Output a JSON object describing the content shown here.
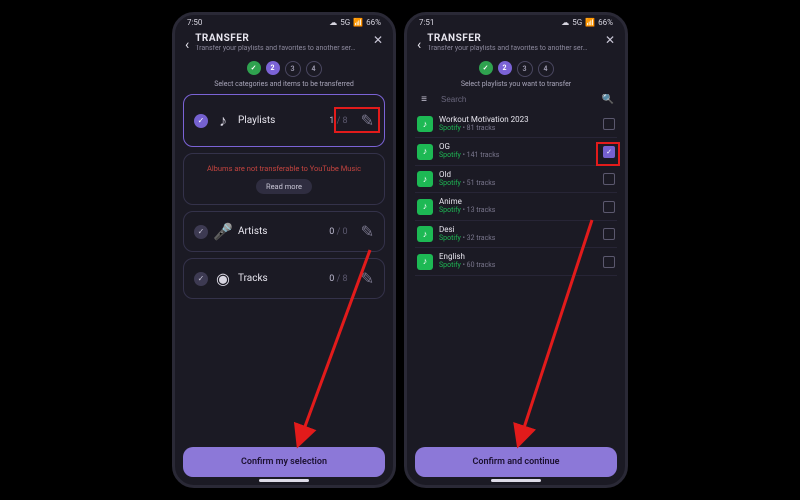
{
  "left": {
    "status": {
      "time": "7:50",
      "net": "5G",
      "battery": "66%"
    },
    "title": "TRANSFER",
    "subtitle": "Transfer your playlists and favorites to another ser…",
    "steps": [
      {
        "label": "✓",
        "state": "done"
      },
      {
        "label": "2",
        "state": "active"
      },
      {
        "label": "3",
        "state": "todo"
      },
      {
        "label": "4",
        "state": "todo"
      }
    ],
    "step_caption": "Select categories and items to be transferred",
    "categories": {
      "playlists": {
        "label": "Playlists",
        "selected": 1,
        "total": 8,
        "checked": true
      },
      "artists": {
        "label": "Artists",
        "selected": 0,
        "total": 0,
        "checked": true
      },
      "tracks": {
        "label": "Tracks",
        "selected": 0,
        "total": 8,
        "checked": true
      }
    },
    "warning": "Albums are not transferable to YouTube Music",
    "read_more": "Read more",
    "confirm": "Confirm my selection"
  },
  "right": {
    "status": {
      "time": "7:51",
      "net": "5G",
      "battery": "66%"
    },
    "title": "TRANSFER",
    "subtitle": "Transfer your playlists and favorites to another ser…",
    "steps": [
      {
        "label": "✓",
        "state": "done"
      },
      {
        "label": "2",
        "state": "active"
      },
      {
        "label": "3",
        "state": "todo"
      },
      {
        "label": "4",
        "state": "todo"
      }
    ],
    "step_caption": "Select playlists you want to transfer",
    "search_placeholder": "Search",
    "playlists": [
      {
        "name": "Workout Motivation 2023",
        "source": "Spotify",
        "tracks": 81,
        "checked": false
      },
      {
        "name": "OG",
        "source": "Spotify",
        "tracks": 141,
        "checked": true
      },
      {
        "name": "Old",
        "source": "Spotify",
        "tracks": 51,
        "checked": false
      },
      {
        "name": "Anime",
        "source": "Spotify",
        "tracks": 13,
        "checked": false
      },
      {
        "name": "Desi",
        "source": "Spotify",
        "tracks": 32,
        "checked": false
      },
      {
        "name": "English",
        "source": "Spotify",
        "tracks": 60,
        "checked": false
      }
    ],
    "confirm": "Confirm and continue"
  },
  "icons": {
    "cloud": "☁",
    "signal": "📶",
    "back": "‹",
    "close": "✕",
    "note": "♪",
    "mic": "🎤",
    "disc": "◉",
    "pencil": "✎",
    "filter": "≡",
    "search": "🔍"
  }
}
